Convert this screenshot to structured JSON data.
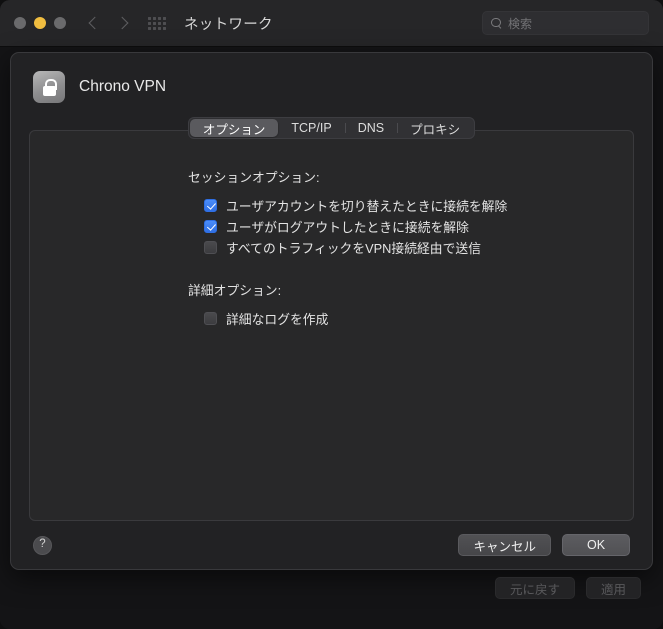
{
  "window": {
    "title": "ネットワーク",
    "traffic_lights": [
      "close",
      "minimize",
      "zoom"
    ],
    "nav_back_icon": "chevron-left-icon",
    "nav_forward_icon": "chevron-right-icon",
    "grid_icon": "grid-view-icon"
  },
  "search": {
    "icon": "search-icon",
    "placeholder": "検索",
    "value": ""
  },
  "sheet": {
    "icon": "lock-icon",
    "title": "Chrono VPN",
    "tabs": [
      {
        "label": "オプション",
        "selected": true
      },
      {
        "label": "TCP/IP",
        "selected": false
      },
      {
        "label": "DNS",
        "selected": false
      },
      {
        "label": "プロキシ",
        "selected": false
      }
    ],
    "groups": [
      {
        "label": "セッションオプション:",
        "items": [
          {
            "label": "ユーザアカウントを切り替えたときに接続を解除",
            "checked": true
          },
          {
            "label": "ユーザがログアウトしたときに接続を解除",
            "checked": true
          },
          {
            "label": "すべてのトラフィックをVPN接続経由で送信",
            "checked": false
          }
        ]
      },
      {
        "label": "詳細オプション:",
        "items": [
          {
            "label": "詳細なログを作成",
            "checked": false
          }
        ]
      }
    ],
    "footer": {
      "help_label": "?",
      "cancel_label": "キャンセル",
      "ok_label": "OK"
    }
  },
  "window_footer": {
    "revert_label": "元に戻す",
    "apply_label": "適用"
  },
  "colors": {
    "accent_checkbox": "#3478f6",
    "traffic_yellow": "#f0bd40",
    "traffic_grey": "#6a6a6c",
    "window_bg": "#1b1b1d",
    "sheet_bg": "#222224",
    "pane_bg": "#282829"
  }
}
